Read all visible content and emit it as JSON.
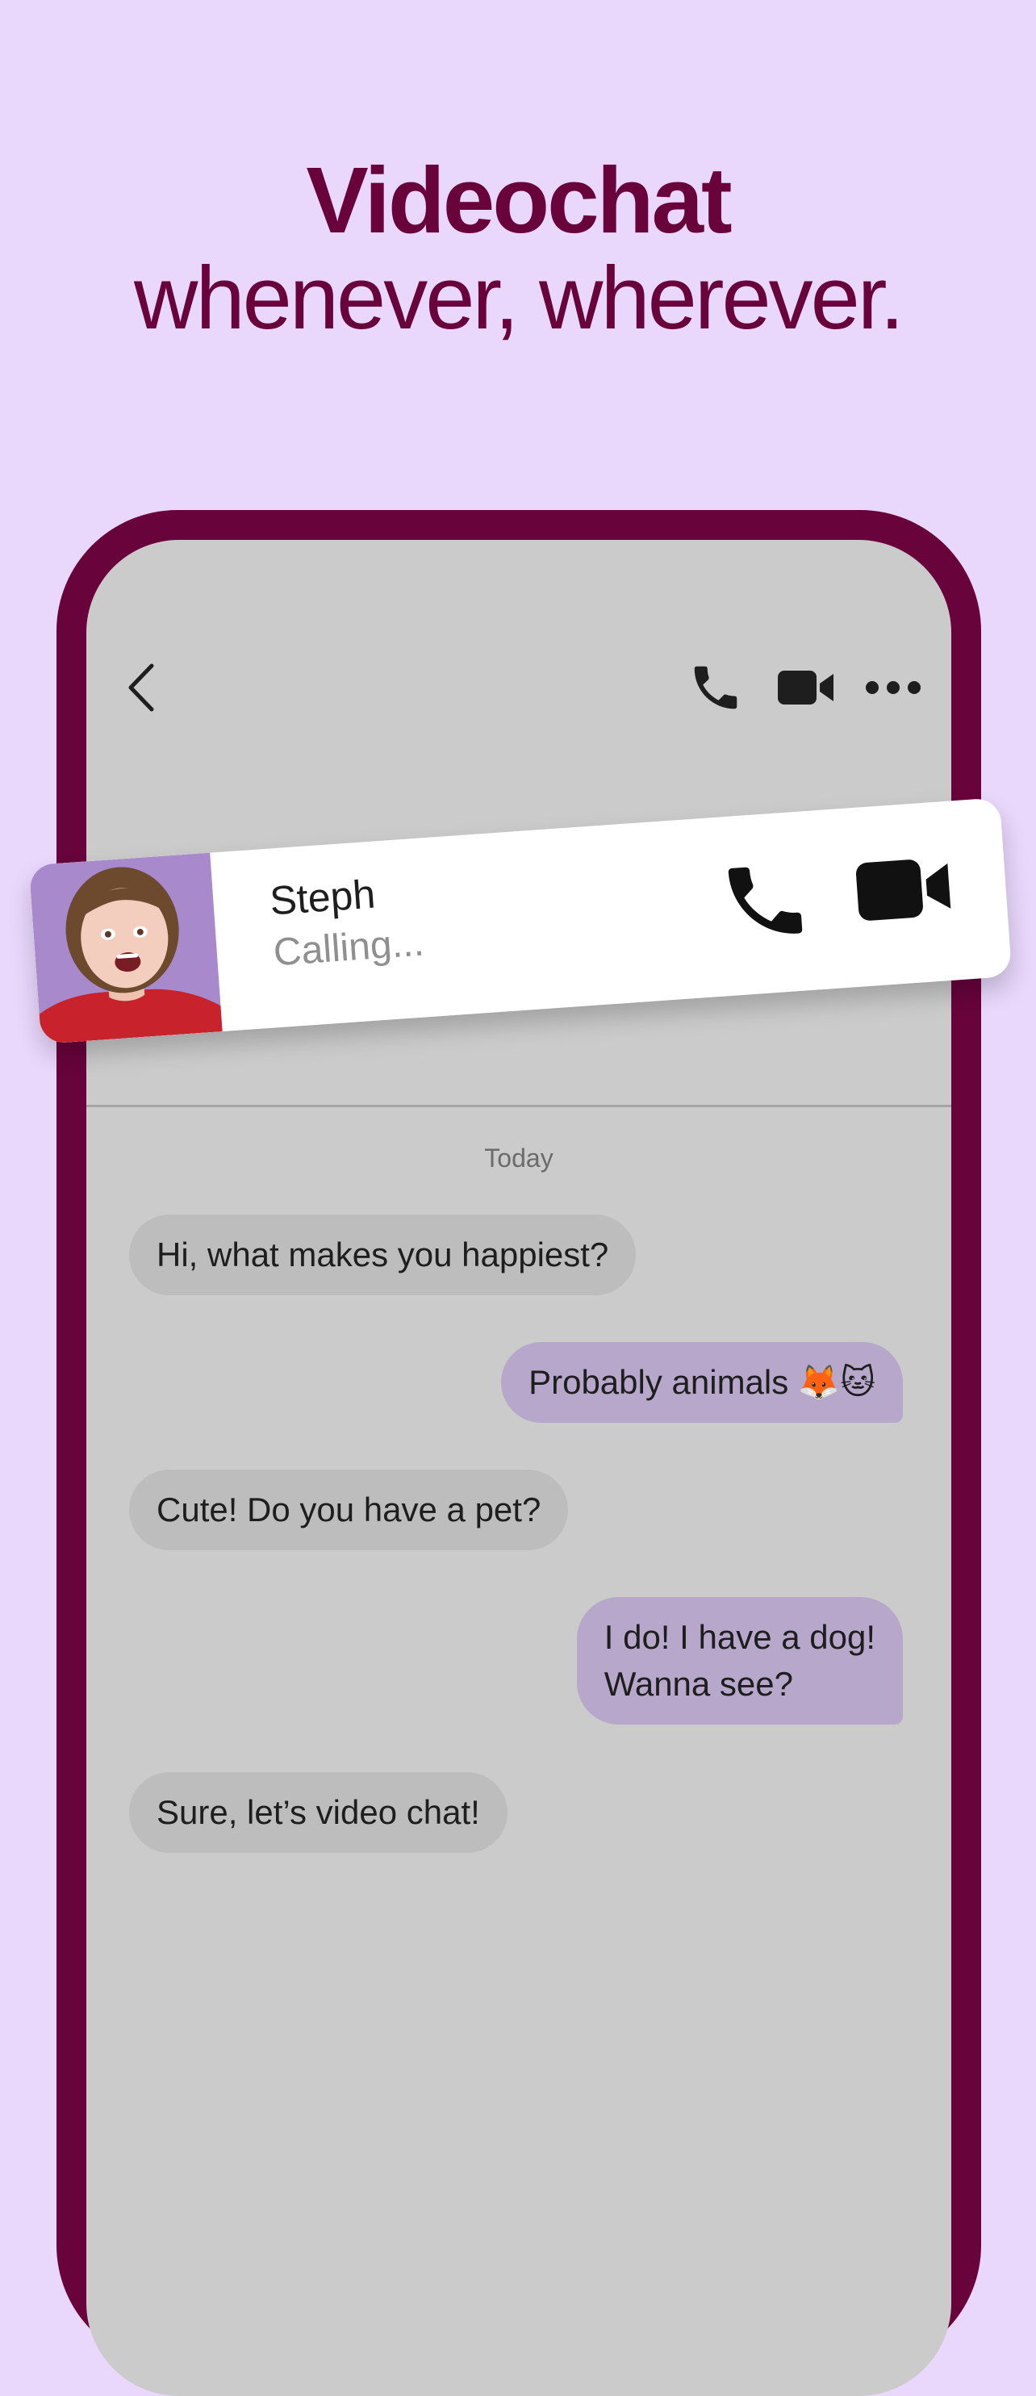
{
  "headline": {
    "bold": "Videochat",
    "regular": "whenever, wherever."
  },
  "top_nav": {
    "back_icon": "chevron-left-icon",
    "phone_icon": "phone-icon",
    "video_icon": "video-camera-icon",
    "more_icon": "more-dots-icon"
  },
  "incoming_call": {
    "caller_name": "Steph",
    "status": "Calling...",
    "voice_icon": "phone-icon",
    "video_icon": "video-camera-icon",
    "avatar_bg": "#a789cc"
  },
  "chat": {
    "date_label": "Today",
    "messages": [
      {
        "direction": "incoming",
        "text": "Hi, what makes you happiest?"
      },
      {
        "direction": "outgoing",
        "text": "Probably animals 🦊🐱"
      },
      {
        "direction": "incoming",
        "text": "Cute! Do you have a pet?"
      },
      {
        "direction": "outgoing",
        "lines": [
          "I do! I have a dog!",
          "Wanna see?"
        ]
      },
      {
        "direction": "incoming",
        "text": "Sure, let’s video chat!"
      }
    ]
  },
  "colors": {
    "background": "#e9d7fc",
    "brand": "#68033c",
    "screen": "#cbcbcb",
    "incoming_bubble": "#bdbdbd",
    "outgoing_bubble": "#b6a7cb"
  }
}
